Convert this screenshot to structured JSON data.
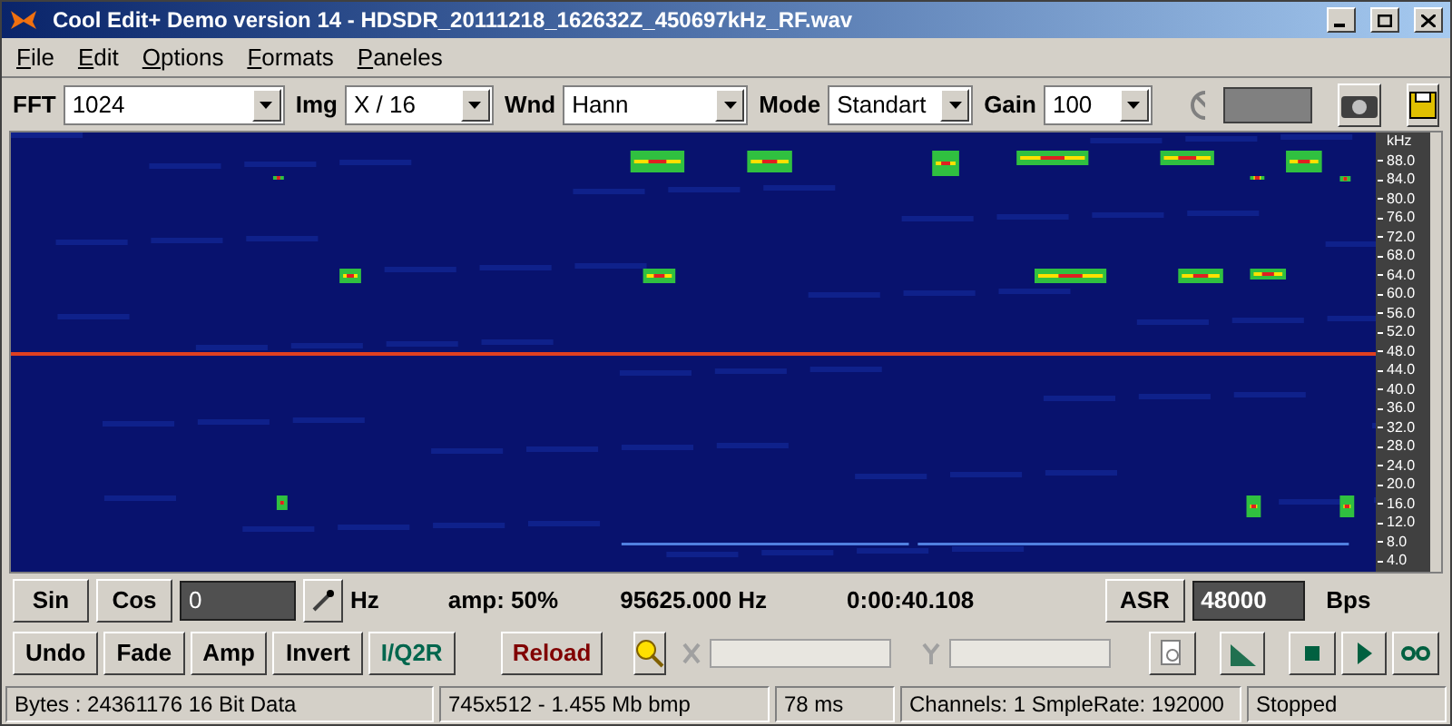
{
  "window": {
    "title": "Cool Edit+  Demo version 14 - HDSDR_20111218_162632Z_450697kHz_RF.wav"
  },
  "menu": [
    "File",
    "Edit",
    "Options",
    "Formats",
    "Paneles"
  ],
  "toolbar": [
    {
      "label": "FFT",
      "value": "1024"
    },
    {
      "label": "Img",
      "value": "X / 16"
    },
    {
      "label": "Wnd",
      "value": "Hann"
    },
    {
      "label": "Mode",
      "value": "Standart"
    },
    {
      "label": "Gain",
      "value": "100"
    }
  ],
  "meter": {
    "level": 0
  },
  "spectrogram": {
    "unit": "kHz",
    "scale": [
      "88.0",
      "84.0",
      "80.0",
      "76.0",
      "72.0",
      "68.0",
      "64.0",
      "60.0",
      "56.0",
      "52.0",
      "48.0",
      "44.0",
      "40.0",
      "36.0",
      "32.0",
      "28.0",
      "24.0",
      "20.0",
      "16.0",
      "12.0",
      "8.0",
      "4.0"
    ]
  },
  "generator": {
    "buttons": [
      "Sin",
      "Cos"
    ],
    "frequency": "0",
    "frequency_unit": "Hz",
    "amp": "amp: 50%",
    "cursor_frequency": "95625.000 Hz",
    "cursor_time": "0:00:40.108",
    "asr_button": "ASR",
    "rate": "48000",
    "rate_unit": "Bps"
  },
  "edit_buttons": [
    {
      "label": "Undo",
      "color": "#000000"
    },
    {
      "label": "Fade",
      "color": "#000000"
    },
    {
      "label": "Amp",
      "color": "#000000"
    },
    {
      "label": "Invert",
      "color": "#000000"
    },
    {
      "label": "I/Q2R",
      "color": "#00664d"
    }
  ],
  "reload_button": "Reload",
  "status_bar": [
    "Bytes : 24361176 16 Bit Data",
    "745x512 - 1.455 Mb bmp",
    "78 ms",
    "Channels: 1  SmpleRate: 192000",
    "Stopped"
  ]
}
